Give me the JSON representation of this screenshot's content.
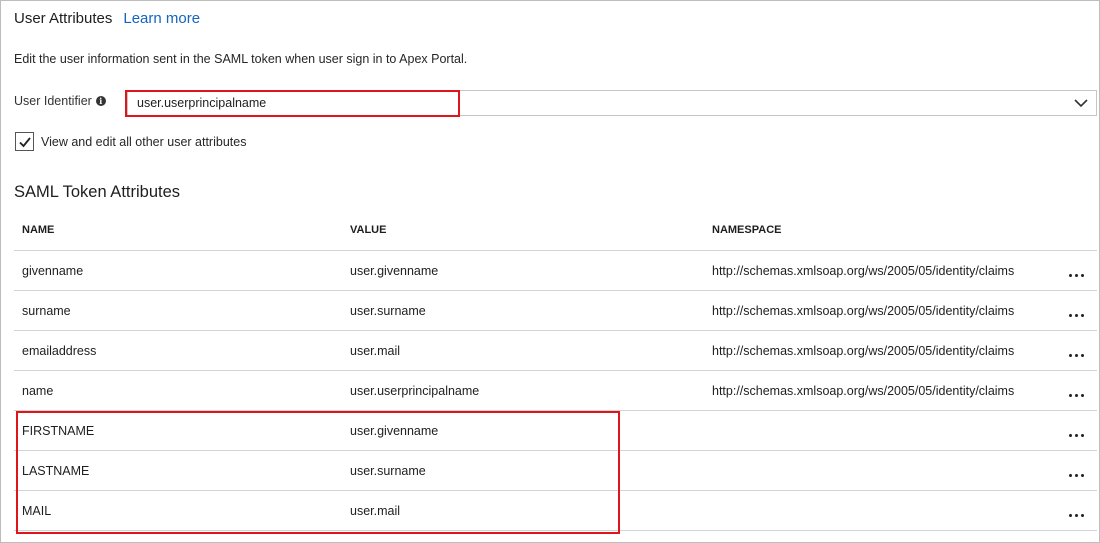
{
  "header": {
    "title": "User Attributes",
    "learn_more": "Learn more"
  },
  "description": "Edit the user information sent in the SAML token when user sign in to Apex Portal.",
  "user_identifier": {
    "label": "User Identifier",
    "value": "user.userprincipalname"
  },
  "checkbox": {
    "label": "View and edit all other user attributes",
    "checked": true
  },
  "saml": {
    "title": "SAML Token Attributes",
    "columns": [
      "NAME",
      "VALUE",
      "NAMESPACE"
    ],
    "rows": [
      {
        "name": "givenname",
        "value": "user.givenname",
        "namespace": "http://schemas.xmlsoap.org/ws/2005/05/identity/claims"
      },
      {
        "name": "surname",
        "value": "user.surname",
        "namespace": "http://schemas.xmlsoap.org/ws/2005/05/identity/claims"
      },
      {
        "name": "emailaddress",
        "value": "user.mail",
        "namespace": "http://schemas.xmlsoap.org/ws/2005/05/identity/claims"
      },
      {
        "name": "name",
        "value": "user.userprincipalname",
        "namespace": "http://schemas.xmlsoap.org/ws/2005/05/identity/claims"
      },
      {
        "name": "FIRSTNAME",
        "value": "user.givenname",
        "namespace": ""
      },
      {
        "name": "LASTNAME",
        "value": "user.surname",
        "namespace": ""
      },
      {
        "name": "MAIL",
        "value": "user.mail",
        "namespace": ""
      }
    ]
  },
  "colors": {
    "link": "#1565c0",
    "highlight": "#e0151b"
  },
  "icons": [
    "info-icon",
    "chevron-down-icon",
    "checkmark-icon",
    "more-options-icon"
  ]
}
